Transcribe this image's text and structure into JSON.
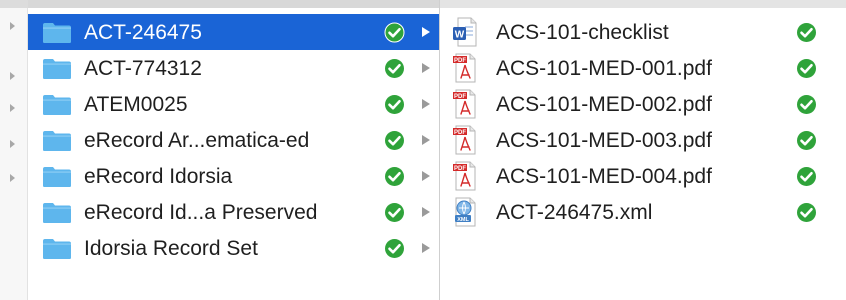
{
  "colors": {
    "selection": "#1a64d6",
    "folder": "#5eb6ed",
    "badge_green": "#2fa33a"
  },
  "folders": [
    {
      "name": "ACT-246475",
      "selected": true,
      "status_icon": "checkmark-badge-icon"
    },
    {
      "name": "ACT-774312",
      "selected": false,
      "status_icon": "checkmark-badge-icon"
    },
    {
      "name": "ATEM0025",
      "selected": false,
      "status_icon": "checkmark-badge-icon"
    },
    {
      "name": "eRecord Ar...ematica-ed",
      "selected": false,
      "status_icon": "checkmark-badge-icon"
    },
    {
      "name": "eRecord Idorsia",
      "selected": false,
      "status_icon": "checkmark-badge-icon"
    },
    {
      "name": "eRecord Id...a Preserved",
      "selected": false,
      "status_icon": "checkmark-badge-icon"
    },
    {
      "name": "Idorsia Record Set",
      "selected": false,
      "status_icon": "checkmark-badge-icon"
    }
  ],
  "files": [
    {
      "name": "ACS-101-checklist",
      "icon": "word-document-icon",
      "status_icon": "checkmark-badge-icon"
    },
    {
      "name": "ACS-101-MED-001.pdf",
      "icon": "pdf-icon",
      "status_icon": "checkmark-badge-icon"
    },
    {
      "name": "ACS-101-MED-002.pdf",
      "icon": "pdf-icon",
      "status_icon": "checkmark-badge-icon"
    },
    {
      "name": "ACS-101-MED-003.pdf",
      "icon": "pdf-icon",
      "status_icon": "checkmark-badge-icon"
    },
    {
      "name": "ACS-101-MED-004.pdf",
      "icon": "pdf-icon",
      "status_icon": "checkmark-badge-icon"
    },
    {
      "name": "ACT-246475.xml",
      "icon": "xml-file-icon",
      "status_icon": "checkmark-badge-icon"
    }
  ]
}
